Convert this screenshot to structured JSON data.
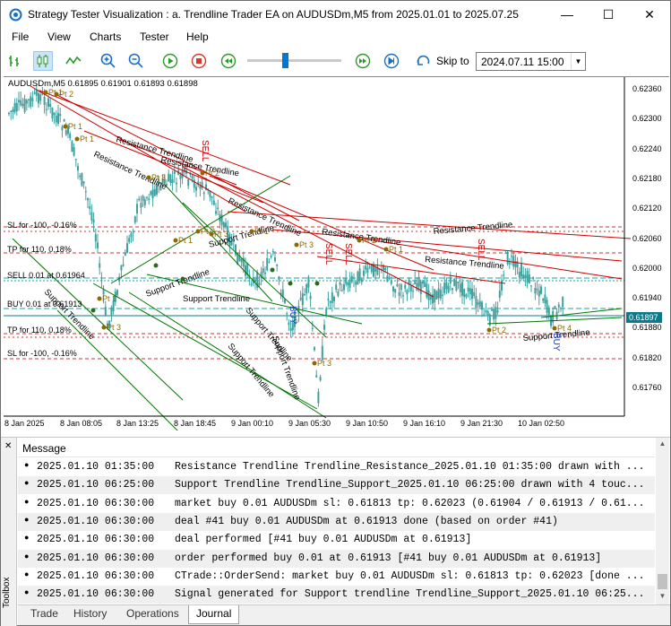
{
  "window": {
    "title": "Strategy Tester Visualization : a. Trendline Trader EA on AUDUSDm,M5 from 2025.01.01 to 2025.07.25",
    "minimize": "—",
    "maximize": "☐",
    "close": "✕"
  },
  "menu": [
    "File",
    "View",
    "Charts",
    "Tester",
    "Help"
  ],
  "toolbar": {
    "icons": [
      "bar-chart-icon",
      "candlestick-icon",
      "line-chart-icon",
      "zoom-in-icon",
      "zoom-out-icon",
      "play-icon",
      "stop-icon",
      "rewind-icon",
      "fast-forward-icon",
      "skip-end-icon",
      "skip-to-icon"
    ],
    "speed_fraction": 0.4,
    "skip_to_label": "Skip to",
    "skip_to_value": "2024.07.11 15:00"
  },
  "chart": {
    "symbol_line": "AUDUSDm,M5  0.61895 0.61901 0.61893 0.61898",
    "price_ticks": [
      "0.62360",
      "0.62300",
      "0.62240",
      "0.62180",
      "0.62120",
      "0.62060",
      "0.62000",
      "0.61940",
      "0.61880",
      "0.61820",
      "0.61760"
    ],
    "current_price": "0.61897",
    "time_ticks": [
      "8 Jan 2025",
      "8 Jan 08:05",
      "8 Jan 13:25",
      "8 Jan 18:45",
      "9 Jan 00:10",
      "9 Jan 05:30",
      "9 Jan 10:50",
      "9 Jan 16:10",
      "9 Jan 21:30",
      "10 Jan 02:50"
    ],
    "level_labels": [
      "SL for -100, -0.16%",
      "TP for 110, 0.18%",
      "SELL 0.01 at 0.61964",
      "BUY 0.01 at 0.61913",
      "TP for 110, 0.18%",
      "SL for -100, -0.16%"
    ],
    "annotations": {
      "resistance": "Resistance Trendline",
      "support": "Support Trendline",
      "sell": "SELL",
      "buy": "BUY",
      "pt1": "Pt 1",
      "pt2": "Pt 2",
      "pt3": "Pt 3",
      "pt4": "Pt 4"
    },
    "colors": {
      "resistance": "#cc0000",
      "support": "#007700",
      "sell": "#cc0000",
      "buy": "#1d3fb8",
      "candles": "#40a0a0",
      "current_price_bg": "#0d7a8a"
    }
  },
  "journal": {
    "header": "Message",
    "rows": [
      {
        "time": "2025.01.10 01:35:00",
        "msg": "Resistance Trendline Trendline_Resistance_2025.01.10 01:35:00 drawn with ..."
      },
      {
        "time": "2025.01.10 06:25:00",
        "msg": "Support Trendline Trendline_Support_2025.01.10 06:25:00 drawn with 4 touc..."
      },
      {
        "time": "2025.01.10 06:30:00",
        "msg": "market buy 0.01 AUDUSDm sl: 0.61813 tp: 0.62023 (0.61904 / 0.61913 / 0.61..."
      },
      {
        "time": "2025.01.10 06:30:00",
        "msg": "deal #41 buy 0.01 AUDUSDm at 0.61913 done (based on order #41)"
      },
      {
        "time": "2025.01.10 06:30:00",
        "msg": "deal performed [#41 buy 0.01 AUDUSDm at 0.61913]"
      },
      {
        "time": "2025.01.10 06:30:00",
        "msg": "order performed buy 0.01 at 0.61913 [#41 buy 0.01 AUDUSDm at 0.61913]"
      },
      {
        "time": "2025.01.10 06:30:00",
        "msg": "CTrade::OrderSend: market buy 0.01 AUDUSDm sl: 0.61813 tp: 0.62023 [done ..."
      },
      {
        "time": "2025.01.10 06:30:00",
        "msg": "Signal generated for Support trendline Trendline_Support_2025.01.10 06:25..."
      }
    ],
    "tabs": [
      "Trade",
      "History",
      "Operations",
      "Journal"
    ],
    "selected_tab": "Journal",
    "toolbox_label": "Toolbox",
    "close_glyph": "✕"
  }
}
